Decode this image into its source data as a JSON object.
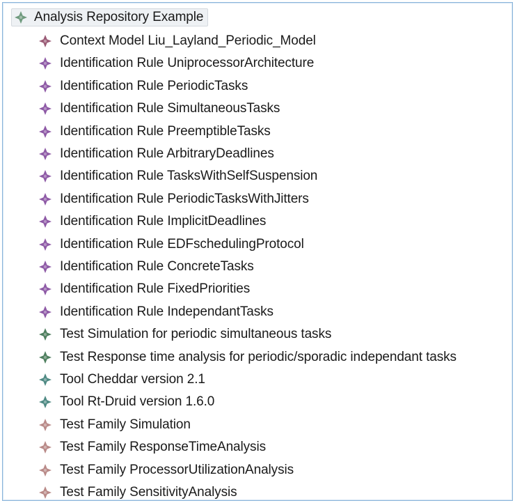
{
  "colors": {
    "root_icon": "#6f9a7e",
    "purple": "#8e5aa6",
    "green": "#4f7f5f",
    "pink": "#b98a88"
  },
  "tree": {
    "root": {
      "label": "Analysis Repository Example",
      "icon": "diamond-plus-icon",
      "color": "#6f9a7e"
    },
    "items": [
      {
        "label": "Context Model Liu_Layland_Periodic_Model",
        "icon": "diamond-plus-icon",
        "color": "#9a5b76"
      },
      {
        "label": "Identification Rule UniprocessorArchitecture",
        "icon": "diamond-plus-icon",
        "color": "#8e5aa6"
      },
      {
        "label": "Identification Rule PeriodicTasks",
        "icon": "diamond-plus-icon",
        "color": "#8e5aa6"
      },
      {
        "label": "Identification Rule SimultaneousTasks",
        "icon": "diamond-plus-icon",
        "color": "#8e5aa6"
      },
      {
        "label": "Identification Rule PreemptibleTasks",
        "icon": "diamond-plus-icon",
        "color": "#8e5aa6"
      },
      {
        "label": "Identification Rule ArbitraryDeadlines",
        "icon": "diamond-plus-icon",
        "color": "#8e5aa6"
      },
      {
        "label": "Identification Rule TasksWithSelfSuspension",
        "icon": "diamond-plus-icon",
        "color": "#8e5aa6"
      },
      {
        "label": "Identification Rule PeriodicTasksWithJitters",
        "icon": "diamond-plus-icon",
        "color": "#8e5aa6"
      },
      {
        "label": "Identification Rule ImplicitDeadlines",
        "icon": "diamond-plus-icon",
        "color": "#8e5aa6"
      },
      {
        "label": "Identification Rule EDFschedulingProtocol",
        "icon": "diamond-plus-icon",
        "color": "#8e5aa6"
      },
      {
        "label": "Identification Rule ConcreteTasks",
        "icon": "diamond-plus-icon",
        "color": "#8e5aa6"
      },
      {
        "label": "Identification Rule FixedPriorities",
        "icon": "diamond-plus-icon",
        "color": "#8e5aa6"
      },
      {
        "label": "Identification Rule IndependantTasks",
        "icon": "diamond-plus-icon",
        "color": "#8e5aa6"
      },
      {
        "label": "Test Simulation for periodic simultaneous tasks",
        "icon": "diamond-plus-icon",
        "color": "#4f7f5f"
      },
      {
        "label": "Test Response time analysis  for periodic/sporadic independant tasks",
        "icon": "diamond-plus-icon",
        "color": "#4f7f5f"
      },
      {
        "label": "Tool Cheddar version 2.1",
        "icon": "diamond-plus-icon",
        "color": "#4f8a84"
      },
      {
        "label": "Tool Rt-Druid version 1.6.0",
        "icon": "diamond-plus-icon",
        "color": "#4f8a84"
      },
      {
        "label": "Test Family Simulation",
        "icon": "diamond-plus-icon",
        "color": "#b98a88"
      },
      {
        "label": "Test Family ResponseTimeAnalysis",
        "icon": "diamond-plus-icon",
        "color": "#b98a88"
      },
      {
        "label": "Test Family ProcessorUtilizationAnalysis",
        "icon": "diamond-plus-icon",
        "color": "#b98a88"
      },
      {
        "label": "Test Family SensitivityAnalysis",
        "icon": "diamond-plus-icon",
        "color": "#b98a88"
      }
    ]
  }
}
